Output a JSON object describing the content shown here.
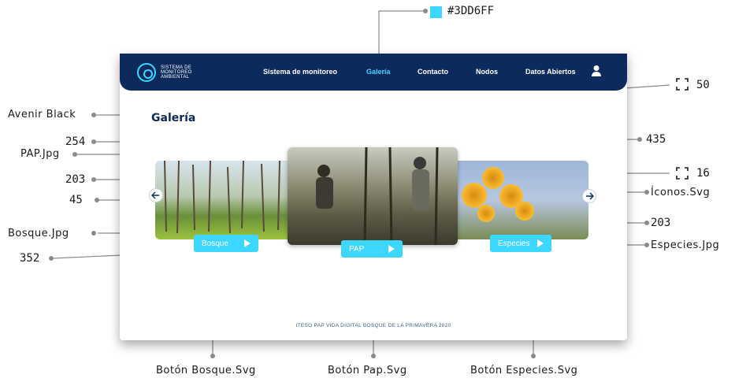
{
  "annotations": {
    "color_hex": "#3DD6FF",
    "navbar_height": "50",
    "font_name": "Avenir Black",
    "pap_width": "254",
    "pap_file": "PAP.Jpg",
    "pap_height": "435",
    "side_height_left": "203",
    "arrow_size": "45",
    "bosque_file": "Bosque.Jpg",
    "bosque_width": "352",
    "icon_size": "16",
    "icons_file": "Íconos.Svg",
    "side_height_right": "203",
    "especies_file": "Especies.Jpg",
    "btn_bosque_file": "Botón Bosque.Svg",
    "btn_pap_file": "Botón Pap.Svg",
    "btn_especies_file": "Botón Especies.Svg"
  },
  "colors": {
    "accent": "#3DD6FF",
    "navy": "#0D2A5C"
  },
  "site": {
    "logo_text": "SISTEMA DE MONITOREO AMBIENTAL",
    "nav": [
      "Sistema de monitoreo",
      "Galería",
      "Contacto",
      "Nodos",
      "Datos Abiertos"
    ],
    "active_nav": "Galería",
    "page_title": "Galería",
    "buttons": {
      "bosque": "Bosque",
      "pap": "PAP",
      "especies": "Especies"
    },
    "footer": "ITESO PAP VIDA DIGITAL BOSQUE DE LA PRIMAVERA 2020"
  }
}
